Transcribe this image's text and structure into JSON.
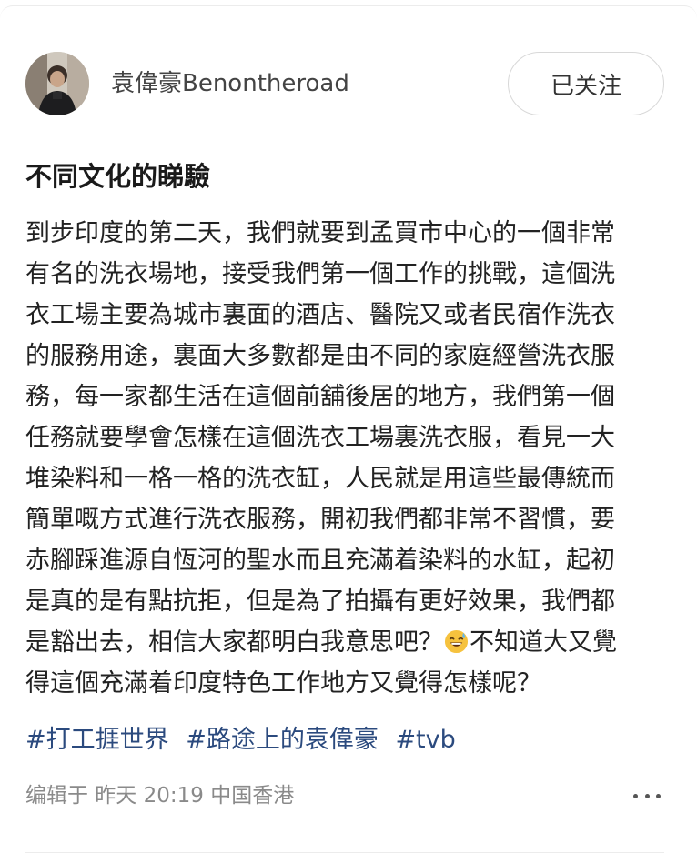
{
  "author": {
    "name": "袁偉豪Benontheroad",
    "avatar_icon": "profile-photo"
  },
  "follow_button": {
    "label": "已关注"
  },
  "post": {
    "title": "不同文化的睇驗",
    "lines": [
      "到步印度的第二天，我們就要到孟買市中心的一個非常",
      "有名的洗衣場地，接受我們第一個工作的挑戰，這個洗",
      "衣工場主要為城市裏面的酒店、醫院又或者民宿作洗衣",
      "的服務用途，裏面大多數都是由不同的家庭經營洗衣服",
      "務，每一家都生活在這個前舖後居的地方，我們第一個",
      "任務就要學會怎樣在這個洗衣工場裏洗衣服，看見一大",
      "堆染料和一格一格的洗衣缸，人民就是用這些最傳統而",
      "簡單嘅方式進行洗衣服務，開初我們都非常不習慣，要",
      "赤腳踩進源自恆河的聖水而且充滿着染料的水缸，起初",
      "是真的是有點抗拒，但是為了拍攝有更好效果，我們都"
    ],
    "line_with_emoji_before": "是豁出去，相信大家都明白我意思吧？",
    "emoji_icon": "grinning-sweat-emoji",
    "line_with_emoji_after": "不知道大又覺",
    "last_line": "得這個充滿着印度特色工作地方又覺得怎樣呢？"
  },
  "tags": [
    "#打工捱世界",
    "#路途上的袁偉豪",
    "#tvb"
  ],
  "meta": {
    "edited_text": "编辑于 昨天 20:19 中国香港"
  },
  "more_icon": "more-horizontal-icon",
  "colors": {
    "tag": "#2b4a7e",
    "meta": "#8a8a8a",
    "text": "#222222"
  }
}
